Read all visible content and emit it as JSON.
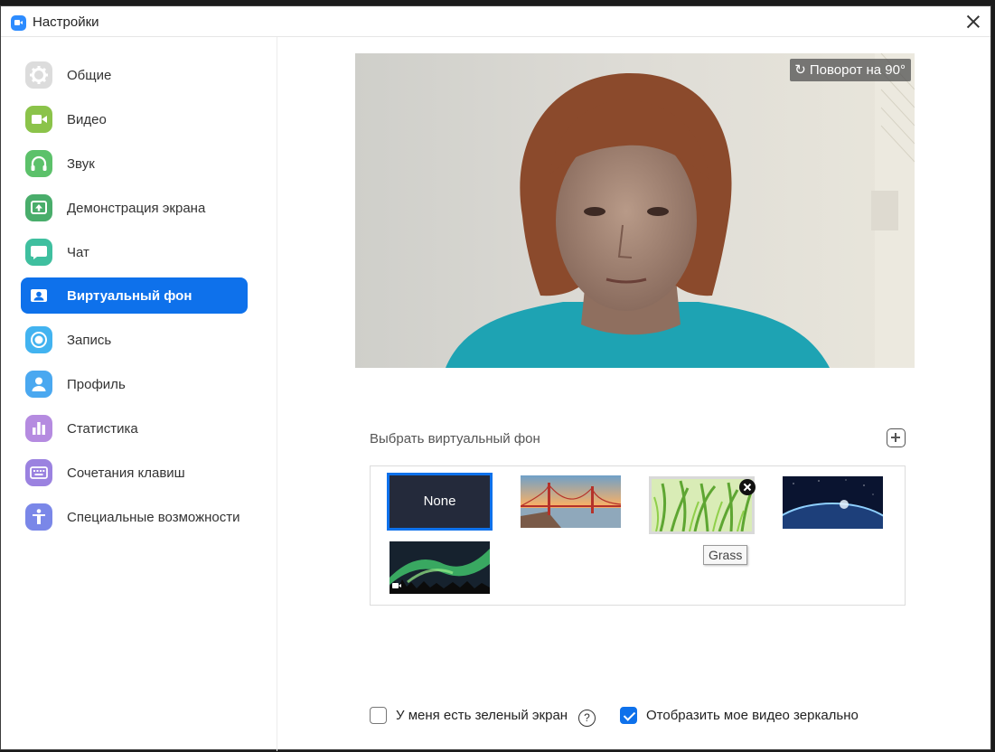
{
  "window": {
    "title": "Настройки",
    "close_label": "×"
  },
  "sidebar": {
    "items": [
      {
        "label": "Общие",
        "icon": "gear-icon",
        "color": "#d8d8d8"
      },
      {
        "label": "Видео",
        "icon": "video-camera-icon",
        "color": "#8bc34a"
      },
      {
        "label": "Звук",
        "icon": "headphones-icon",
        "color": "#5fc46a"
      },
      {
        "label": "Демонстрация экрана",
        "icon": "share-screen-icon",
        "color": "#4caf73"
      },
      {
        "label": "Чат",
        "icon": "chat-bubble-icon",
        "color": "#40bfa0"
      },
      {
        "label": "Виртуальный фон",
        "icon": "person-card-icon",
        "color": "#0e71eb",
        "active": true
      },
      {
        "label": "Запись",
        "icon": "record-icon",
        "color": "#42b3f0"
      },
      {
        "label": "Профиль",
        "icon": "user-icon",
        "color": "#4aa8f0"
      },
      {
        "label": "Статистика",
        "icon": "bar-chart-icon",
        "color": "#b58be0"
      },
      {
        "label": "Сочетания клавиш",
        "icon": "keyboard-icon",
        "color": "#9b82e0"
      },
      {
        "label": "Специальные возможности",
        "icon": "accessibility-icon",
        "color": "#7a87e8"
      }
    ]
  },
  "preview": {
    "rotate_label": "Поворот на 90°"
  },
  "backgrounds": {
    "section_label": "Выбрать виртуальный фон",
    "items": [
      {
        "label": "None",
        "selected": true
      },
      {
        "label": "Golden Gate"
      },
      {
        "label": "Grass",
        "hovered": true
      },
      {
        "label": "Earth"
      },
      {
        "label": "Aurora",
        "is_video": true
      }
    ],
    "tooltip": "Grass"
  },
  "options": {
    "green_screen_label": "У меня есть зеленый экран",
    "green_screen_checked": false,
    "mirror_label": "Отобразить мое видео зеркально",
    "mirror_checked": true,
    "help_label": "?"
  }
}
